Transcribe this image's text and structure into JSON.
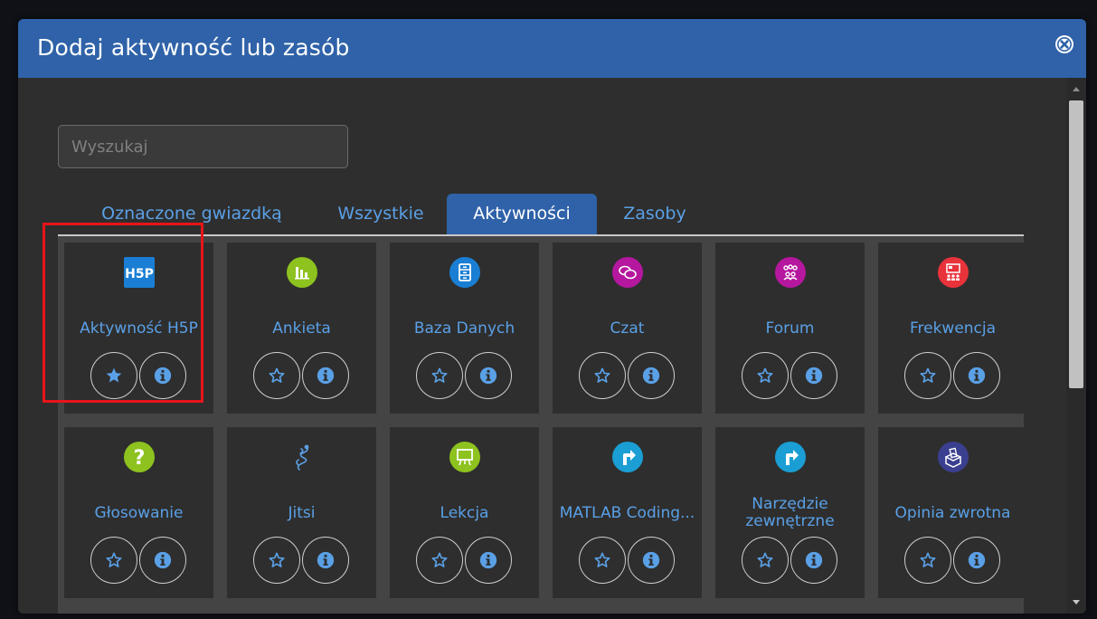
{
  "modal": {
    "title": "Dodaj aktywność lub zasób",
    "header_color": "#2f62a8",
    "close_icon": "close-circle-icon"
  },
  "search": {
    "placeholder": "Wyszukaj",
    "value": ""
  },
  "tabs": [
    {
      "label": "Oznaczone gwiazdką",
      "active": false
    },
    {
      "label": "Wszystkie",
      "active": false
    },
    {
      "label": "Aktywności",
      "active": true
    },
    {
      "label": "Zasoby",
      "active": false
    }
  ],
  "modules": [
    {
      "label": "Aktywność H5P",
      "icon": "h5p-icon",
      "color": "#1a7fd4",
      "starred": true,
      "highlighted": true
    },
    {
      "label": "Ankieta",
      "icon": "chart-bars-icon",
      "color": "#8dc21f",
      "starred": false
    },
    {
      "label": "Baza Danych",
      "icon": "database-icon",
      "color": "#1a7fd4",
      "starred": false
    },
    {
      "label": "Czat",
      "icon": "chat-bubbles-icon",
      "color": "#b5179e",
      "starred": false
    },
    {
      "label": "Forum",
      "icon": "people-group-icon",
      "color": "#b5179e",
      "starred": false
    },
    {
      "label": "Frekwencja",
      "icon": "attendance-icon",
      "color": "#e8333b",
      "starred": false
    },
    {
      "label": "Głosowanie",
      "icon": "question-mark-icon",
      "color": "#8dc21f",
      "starred": false
    },
    {
      "label": "Jitsi",
      "icon": "jitsi-icon",
      "color": "#5aa0e6",
      "starred": false
    },
    {
      "label": "Lekcja",
      "icon": "presentation-board-icon",
      "color": "#8dc21f",
      "starred": false
    },
    {
      "label": "MATLAB Coding...",
      "icon": "external-arrow-icon",
      "color": "#1a9ed4",
      "starred": false
    },
    {
      "label": "Narzędzie zewnętrzne",
      "icon": "external-arrow-icon",
      "color": "#1a9ed4",
      "starred": false
    },
    {
      "label": "Opinia zwrotna",
      "icon": "feedback-box-icon",
      "color": "#3b3f8f",
      "starred": false
    }
  ],
  "colors": {
    "accent": "#2f62a8",
    "link": "#5aa0e6",
    "highlight": "#e8141a",
    "background": "#2e2e2e"
  }
}
